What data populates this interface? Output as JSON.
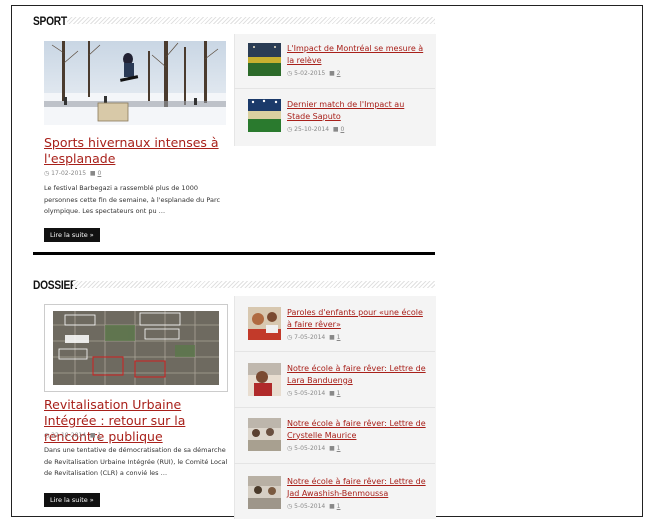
{
  "sections": [
    {
      "title": "SPORT",
      "main": {
        "title": "Sports hivernaux intenses à l'esplanade",
        "date": "17-02-2015",
        "comments": "0",
        "excerpt": "Le festival Barbegazi a rassemblé plus de 1000 personnes cette fin de semaine, à l'esplanade du Parc olympique. Les spectateurs ont pu …",
        "more": "Lire la suite »"
      },
      "side": [
        {
          "title": "L'Impact de Montréal se mesure à la relève",
          "date": "5-02-2015",
          "comments": "2"
        },
        {
          "title": "Dernier match de l'Impact au Stade Saputo",
          "date": "25-10-2014",
          "comments": "0"
        }
      ]
    },
    {
      "title": "DOSSIER",
      "main": {
        "title": "Revitalisation Urbaine Intégrée : retour sur la rencontre publique",
        "date": "22-10-2014",
        "comments": "1",
        "excerpt": "Dans une tentative de démocratisation de sa démarche de Revitalisation Urbaine Intégrée (RUI), le Comité Local de Revitalisation (CLR) a convié les …",
        "more": "Lire la suite »"
      },
      "side": [
        {
          "title": "Paroles d'enfants pour «une école à faire rêver»",
          "date": "7-05-2014",
          "comments": "1"
        },
        {
          "title": "Notre école à faire rêver: Lettre de Lara Banduenga",
          "date": "5-05-2014",
          "comments": "1"
        },
        {
          "title": "Notre école à faire rêver: Lettre de Crystelle Maurice",
          "date": "5-05-2014",
          "comments": "1"
        },
        {
          "title": "Notre école à faire rêver: Lettre de Jad Awashish-Benmoussa",
          "date": "5-05-2014",
          "comments": "1"
        }
      ]
    }
  ],
  "icons": {
    "date": "clock-icon",
    "comments": "comment-bubble-icon"
  },
  "colors": {
    "link": "#a8201a",
    "button": "#111111",
    "sidebar_bg": "#f4f4f4"
  }
}
